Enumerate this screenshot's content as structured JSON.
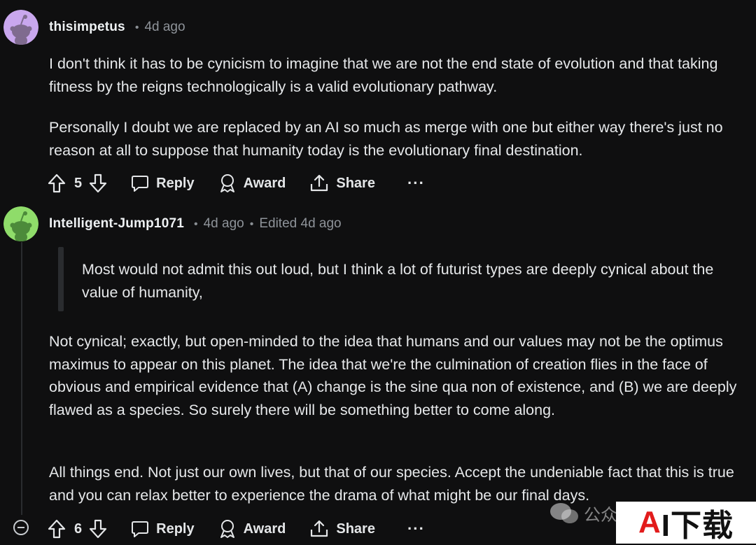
{
  "comments": [
    {
      "username": "thisimpetus",
      "time": "4d ago",
      "paragraphs": [
        "I don't think it has to be cynicism to imagine that we are not the end state of evolution and that taking fitness by the reigns technologically is a valid evolutionary pathway.",
        "Personally I doubt we are replaced by an AI so much as merge with one but either way there's just no reason at all to suppose that humanity today is the evolutionary final destination."
      ],
      "votes": "5",
      "actions": {
        "reply": "Reply",
        "award": "Award",
        "share": "Share",
        "more": "···"
      },
      "avatar_color": "#c9a7ee"
    },
    {
      "username": "Intelligent-Jump1071",
      "time": "4d ago",
      "edited": "Edited 4d ago",
      "quote": "Most would not admit this out loud, but I think a lot of futurist types are deeply cynical about the value of humanity,",
      "paragraphs": [
        "Not cynical; exactly, but open-minded to the idea that humans and our values may not be the optimus maximus to appear on this planet. The idea that we're the culmination of creation flies in the face of obvious and empirical evidence that (A) change is the sine qua non of existence, and (B) we are deeply flawed as a species. So surely there will be something better to come along.",
        "All things end. Not just our own lives, but that of our species. Accept the undeniable fact that this is true and you can relax better to experience the drama of what might be our final days."
      ],
      "votes": "6",
      "actions": {
        "reply": "Reply",
        "award": "Award",
        "share": "Share",
        "more": "···"
      },
      "avatar_color": "#8fdc6a"
    }
  ],
  "watermark": {
    "text": "公众",
    "logo_a": "A",
    "logo_rest": "I下载"
  }
}
